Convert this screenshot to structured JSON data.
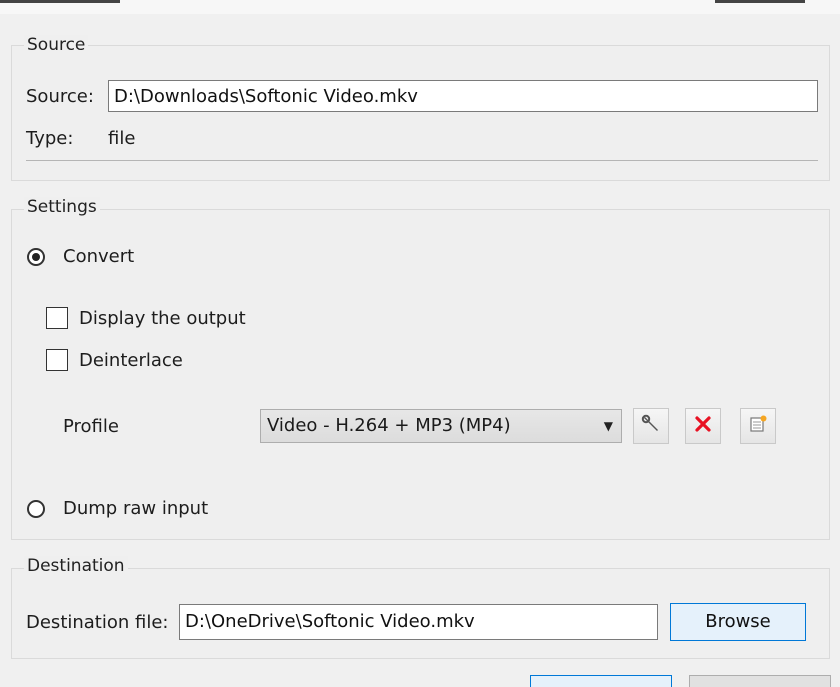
{
  "source_group": {
    "title": "Source",
    "source_label": "Source:",
    "source_value": "D:\\Downloads\\Softonic Video.mkv",
    "type_label": "Type:",
    "type_value": "file"
  },
  "settings_group": {
    "title": "Settings",
    "convert_label": "Convert",
    "convert_selected": true,
    "display_output_label": "Display the output",
    "display_output_checked": false,
    "deinterlace_label": "Deinterlace",
    "deinterlace_checked": false,
    "profile_label": "Profile",
    "profile_selected": "Video - H.264 + MP3 (MP4)",
    "dump_raw_label": "Dump raw input",
    "dump_raw_selected": false
  },
  "destination_group": {
    "title": "Destination",
    "dest_label": "Destination file:",
    "dest_value": "D:\\OneDrive\\Softonic Video.mkv",
    "browse_label": "Browse"
  },
  "icons": {
    "edit_profile": "wrench-icon",
    "delete_profile": "red-x-icon",
    "new_profile": "new-profile-icon",
    "combo_arrow": "chevron-down-icon"
  },
  "colors": {
    "delete_red": "#e81123",
    "focus_blue": "#0078d7"
  }
}
